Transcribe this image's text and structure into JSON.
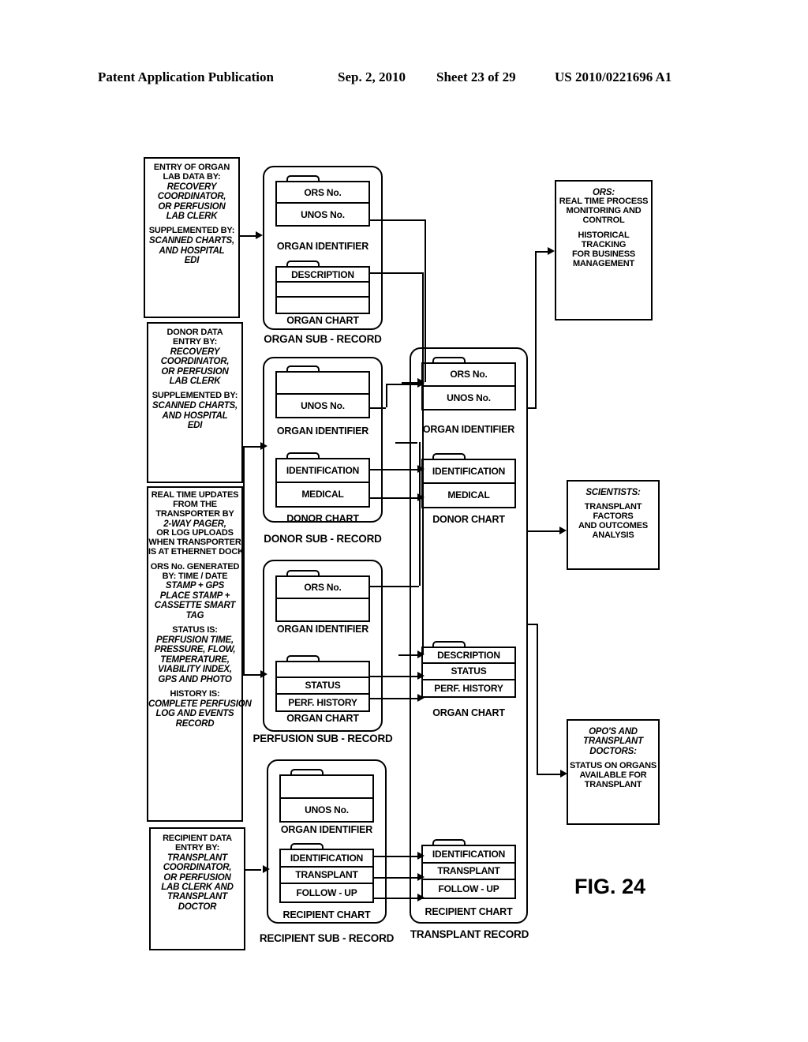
{
  "header": {
    "publication": "Patent Application Publication",
    "date": "Sep. 2, 2010",
    "sheet": "Sheet 23 of 29",
    "number": "US 2010/0221696 A1"
  },
  "figure_label": "FIG. 24",
  "inputs": [
    {
      "name": "organ-lab-data-entry",
      "lines": [
        {
          "t": "ENTRY OF ORGAN",
          "s": "reg"
        },
        {
          "t": "LAB DATA BY:",
          "s": "reg"
        },
        {
          "t": "RECOVERY",
          "s": "ital"
        },
        {
          "t": "COORDINATOR,",
          "s": "ital"
        },
        {
          "t": "OR PERFUSION",
          "s": "ital"
        },
        {
          "t": "LAB CLERK",
          "s": "ital"
        },
        {
          "t": "",
          "s": "gap"
        },
        {
          "t": "SUPPLEMENTED BY:",
          "s": "reg"
        },
        {
          "t": "SCANNED CHARTS,",
          "s": "ital"
        },
        {
          "t": "AND HOSPITAL",
          "s": "ital"
        },
        {
          "t": "EDI",
          "s": "ital"
        }
      ]
    },
    {
      "name": "donor-data-entry",
      "lines": [
        {
          "t": "DONOR DATA",
          "s": "reg"
        },
        {
          "t": "ENTRY BY:",
          "s": "reg"
        },
        {
          "t": "RECOVERY",
          "s": "ital"
        },
        {
          "t": "COORDINATOR,",
          "s": "ital"
        },
        {
          "t": "OR PERFUSION",
          "s": "ital"
        },
        {
          "t": "LAB CLERK",
          "s": "ital"
        },
        {
          "t": "",
          "s": "gap"
        },
        {
          "t": "SUPPLEMENTED BY:",
          "s": "reg"
        },
        {
          "t": "SCANNED CHARTS,",
          "s": "ital"
        },
        {
          "t": "AND HOSPITAL",
          "s": "ital"
        },
        {
          "t": "EDI",
          "s": "ital"
        }
      ]
    },
    {
      "name": "real-time-updates",
      "lines": [
        {
          "t": "REAL TIME UPDATES",
          "s": "reg"
        },
        {
          "t": "FROM THE",
          "s": "reg"
        },
        {
          "t": "TRANSPORTER BY",
          "s": "reg"
        },
        {
          "t": "2-WAY PAGER,",
          "s": "ital"
        },
        {
          "t": "OR LOG UPLOADS",
          "s": "reg"
        },
        {
          "t": "WHEN TRANSPORTER",
          "s": "reg"
        },
        {
          "t": "IS AT ETHERNET DOCK",
          "s": "reg"
        },
        {
          "t": "",
          "s": "gap"
        },
        {
          "t": "ORS No. GENERATED",
          "s": "reg"
        },
        {
          "t": "BY: TIME / DATE",
          "s": "reg"
        },
        {
          "t": "STAMP + GPS",
          "s": "ital"
        },
        {
          "t": "PLACE STAMP +",
          "s": "ital"
        },
        {
          "t": "CASSETTE SMART",
          "s": "ital"
        },
        {
          "t": "TAG",
          "s": "ital"
        },
        {
          "t": "",
          "s": "gap"
        },
        {
          "t": "STATUS IS:",
          "s": "reg"
        },
        {
          "t": "PERFUSION TIME,",
          "s": "ital"
        },
        {
          "t": "PRESSURE, FLOW,",
          "s": "ital"
        },
        {
          "t": "TEMPERATURE,",
          "s": "ital"
        },
        {
          "t": "VIABILITY INDEX,",
          "s": "ital"
        },
        {
          "t": "GPS AND PHOTO",
          "s": "ital"
        },
        {
          "t": "",
          "s": "gap"
        },
        {
          "t": "HISTORY IS:",
          "s": "reg"
        },
        {
          "t": "COMPLETE PERFUSION",
          "s": "ital"
        },
        {
          "t": "LOG AND EVENTS",
          "s": "ital"
        },
        {
          "t": "RECORD",
          "s": "ital"
        }
      ]
    },
    {
      "name": "recipient-data-entry",
      "lines": [
        {
          "t": "RECIPIENT DATA",
          "s": "reg"
        },
        {
          "t": "ENTRY BY:",
          "s": "reg"
        },
        {
          "t": "TRANSPLANT",
          "s": "ital"
        },
        {
          "t": "COORDINATOR,",
          "s": "ital"
        },
        {
          "t": "OR PERFUSION",
          "s": "ital"
        },
        {
          "t": "LAB CLERK AND",
          "s": "ital"
        },
        {
          "t": "TRANSPLANT",
          "s": "ital"
        },
        {
          "t": "DOCTOR",
          "s": "ital"
        }
      ]
    }
  ],
  "sub_records": [
    {
      "name": "organ-sub-record",
      "label": "ORGAN SUB - RECORD",
      "folders": [
        {
          "label": "ORGAN IDENTIFIER",
          "rows": [
            "ORS No.",
            "UNOS No."
          ]
        },
        {
          "label": "ORGAN CHART",
          "rows": [
            "DESCRIPTION",
            "",
            ""
          ]
        }
      ]
    },
    {
      "name": "donor-sub-record",
      "label": "DONOR SUB - RECORD",
      "folders": [
        {
          "label": "ORGAN IDENTIFIER",
          "rows": [
            "",
            "UNOS No."
          ]
        },
        {
          "label": "DONOR CHART",
          "rows": [
            "IDENTIFICATION",
            "MEDICAL"
          ]
        }
      ]
    },
    {
      "name": "perfusion-sub-record",
      "label": "PERFUSION SUB - RECORD",
      "folders": [
        {
          "label": "ORGAN IDENTIFIER",
          "rows": [
            "ORS No.",
            ""
          ]
        },
        {
          "label": "ORGAN CHART",
          "rows": [
            "",
            "STATUS",
            "PERF. HISTORY"
          ]
        }
      ]
    },
    {
      "name": "recipient-sub-record",
      "label": "RECIPIENT SUB - RECORD",
      "folders": [
        {
          "label": "ORGAN IDENTIFIER",
          "rows": [
            "",
            "UNOS No."
          ]
        },
        {
          "label": "RECIPIENT CHART",
          "rows": [
            "IDENTIFICATION",
            "TRANSPLANT",
            "FOLLOW - UP"
          ]
        }
      ]
    }
  ],
  "transplant_record": {
    "name": "transplant-record",
    "label": "TRANSPLANT RECORD",
    "folders": [
      {
        "label": "ORGAN IDENTIFIER",
        "rows": [
          "ORS No.",
          "UNOS No."
        ]
      },
      {
        "label": "DONOR CHART",
        "rows": [
          "IDENTIFICATION",
          "MEDICAL"
        ]
      },
      {
        "label": "ORGAN CHART",
        "rows": [
          "DESCRIPTION",
          "STATUS",
          "PERF. HISTORY"
        ]
      },
      {
        "label": "RECIPIENT CHART",
        "rows": [
          "IDENTIFICATION",
          "TRANSPLANT",
          "FOLLOW - UP"
        ]
      }
    ]
  },
  "outputs": [
    {
      "name": "ors-monitoring-output",
      "lines": [
        {
          "t": "ORS:",
          "s": "ital"
        },
        {
          "t": "REAL TIME PROCESS",
          "s": "reg"
        },
        {
          "t": "MONITORING AND",
          "s": "reg"
        },
        {
          "t": "CONTROL",
          "s": "reg"
        },
        {
          "t": "",
          "s": "gap"
        },
        {
          "t": "HISTORICAL",
          "s": "reg"
        },
        {
          "t": "TRACKING",
          "s": "reg"
        },
        {
          "t": "FOR BUSINESS",
          "s": "reg"
        },
        {
          "t": "MANAGEMENT",
          "s": "reg"
        }
      ]
    },
    {
      "name": "scientists-output",
      "lines": [
        {
          "t": "SCIENTISTS:",
          "s": "ital"
        },
        {
          "t": "",
          "s": "gap"
        },
        {
          "t": "TRANSPLANT",
          "s": "reg"
        },
        {
          "t": "FACTORS",
          "s": "reg"
        },
        {
          "t": "AND OUTCOMES",
          "s": "reg"
        },
        {
          "t": "ANALYSIS",
          "s": "reg"
        }
      ]
    },
    {
      "name": "opo-doctors-output",
      "lines": [
        {
          "t": "OPO'S AND",
          "s": "ital"
        },
        {
          "t": "TRANSPLANT",
          "s": "ital"
        },
        {
          "t": "DOCTORS:",
          "s": "ital"
        },
        {
          "t": "",
          "s": "gap"
        },
        {
          "t": "STATUS ON ORGANS",
          "s": "reg"
        },
        {
          "t": "AVAILABLE FOR",
          "s": "reg"
        },
        {
          "t": "TRANSPLANT",
          "s": "reg"
        }
      ]
    }
  ]
}
